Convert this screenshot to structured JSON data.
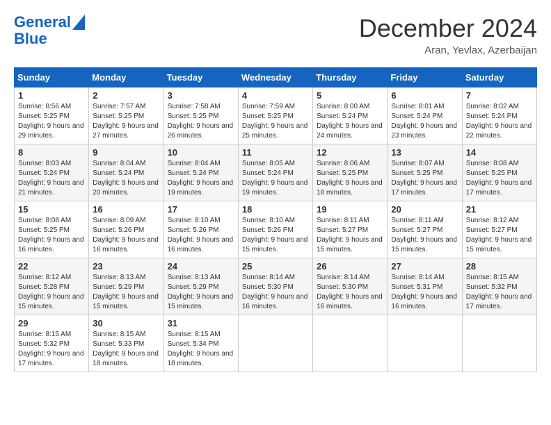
{
  "header": {
    "logo_line1": "General",
    "logo_line2": "Blue",
    "month": "December 2024",
    "location": "Aran, Yevlax, Azerbaijan"
  },
  "weekdays": [
    "Sunday",
    "Monday",
    "Tuesday",
    "Wednesday",
    "Thursday",
    "Friday",
    "Saturday"
  ],
  "weeks": [
    [
      {
        "day": "1",
        "sunrise": "8:56 AM",
        "sunset": "5:25 PM",
        "daylight": "9 hours and 29 minutes."
      },
      {
        "day": "2",
        "sunrise": "7:57 AM",
        "sunset": "5:25 PM",
        "daylight": "9 hours and 27 minutes."
      },
      {
        "day": "3",
        "sunrise": "7:58 AM",
        "sunset": "5:25 PM",
        "daylight": "9 hours and 26 minutes."
      },
      {
        "day": "4",
        "sunrise": "7:59 AM",
        "sunset": "5:25 PM",
        "daylight": "9 hours and 25 minutes."
      },
      {
        "day": "5",
        "sunrise": "8:00 AM",
        "sunset": "5:24 PM",
        "daylight": "9 hours and 24 minutes."
      },
      {
        "day": "6",
        "sunrise": "8:01 AM",
        "sunset": "5:24 PM",
        "daylight": "9 hours and 23 minutes."
      },
      {
        "day": "7",
        "sunrise": "8:02 AM",
        "sunset": "5:24 PM",
        "daylight": "9 hours and 22 minutes."
      }
    ],
    [
      {
        "day": "8",
        "sunrise": "8:03 AM",
        "sunset": "5:24 PM",
        "daylight": "9 hours and 21 minutes."
      },
      {
        "day": "9",
        "sunrise": "8:04 AM",
        "sunset": "5:24 PM",
        "daylight": "9 hours and 20 minutes."
      },
      {
        "day": "10",
        "sunrise": "8:04 AM",
        "sunset": "5:24 PM",
        "daylight": "9 hours and 19 minutes."
      },
      {
        "day": "11",
        "sunrise": "8:05 AM",
        "sunset": "5:24 PM",
        "daylight": "9 hours and 19 minutes."
      },
      {
        "day": "12",
        "sunrise": "8:06 AM",
        "sunset": "5:25 PM",
        "daylight": "9 hours and 18 minutes."
      },
      {
        "day": "13",
        "sunrise": "8:07 AM",
        "sunset": "5:25 PM",
        "daylight": "9 hours and 17 minutes."
      },
      {
        "day": "14",
        "sunrise": "8:08 AM",
        "sunset": "5:25 PM",
        "daylight": "9 hours and 17 minutes."
      }
    ],
    [
      {
        "day": "15",
        "sunrise": "8:08 AM",
        "sunset": "5:25 PM",
        "daylight": "9 hours and 16 minutes."
      },
      {
        "day": "16",
        "sunrise": "8:09 AM",
        "sunset": "5:26 PM",
        "daylight": "9 hours and 16 minutes."
      },
      {
        "day": "17",
        "sunrise": "8:10 AM",
        "sunset": "5:26 PM",
        "daylight": "9 hours and 16 minutes."
      },
      {
        "day": "18",
        "sunrise": "8:10 AM",
        "sunset": "5:26 PM",
        "daylight": "9 hours and 15 minutes."
      },
      {
        "day": "19",
        "sunrise": "8:11 AM",
        "sunset": "5:27 PM",
        "daylight": "9 hours and 15 minutes."
      },
      {
        "day": "20",
        "sunrise": "8:11 AM",
        "sunset": "5:27 PM",
        "daylight": "9 hours and 15 minutes."
      },
      {
        "day": "21",
        "sunrise": "8:12 AM",
        "sunset": "5:27 PM",
        "daylight": "9 hours and 15 minutes."
      }
    ],
    [
      {
        "day": "22",
        "sunrise": "8:12 AM",
        "sunset": "5:28 PM",
        "daylight": "9 hours and 15 minutes."
      },
      {
        "day": "23",
        "sunrise": "8:13 AM",
        "sunset": "5:29 PM",
        "daylight": "9 hours and 15 minutes."
      },
      {
        "day": "24",
        "sunrise": "8:13 AM",
        "sunset": "5:29 PM",
        "daylight": "9 hours and 15 minutes."
      },
      {
        "day": "25",
        "sunrise": "8:14 AM",
        "sunset": "5:30 PM",
        "daylight": "9 hours and 16 minutes."
      },
      {
        "day": "26",
        "sunrise": "8:14 AM",
        "sunset": "5:30 PM",
        "daylight": "9 hours and 16 minutes."
      },
      {
        "day": "27",
        "sunrise": "8:14 AM",
        "sunset": "5:31 PM",
        "daylight": "9 hours and 16 minutes."
      },
      {
        "day": "28",
        "sunrise": "8:15 AM",
        "sunset": "5:32 PM",
        "daylight": "9 hours and 17 minutes."
      }
    ],
    [
      {
        "day": "29",
        "sunrise": "8:15 AM",
        "sunset": "5:32 PM",
        "daylight": "9 hours and 17 minutes."
      },
      {
        "day": "30",
        "sunrise": "8:15 AM",
        "sunset": "5:33 PM",
        "daylight": "9 hours and 18 minutes."
      },
      {
        "day": "31",
        "sunrise": "8:15 AM",
        "sunset": "5:34 PM",
        "daylight": "9 hours and 18 minutes."
      },
      null,
      null,
      null,
      null
    ]
  ]
}
